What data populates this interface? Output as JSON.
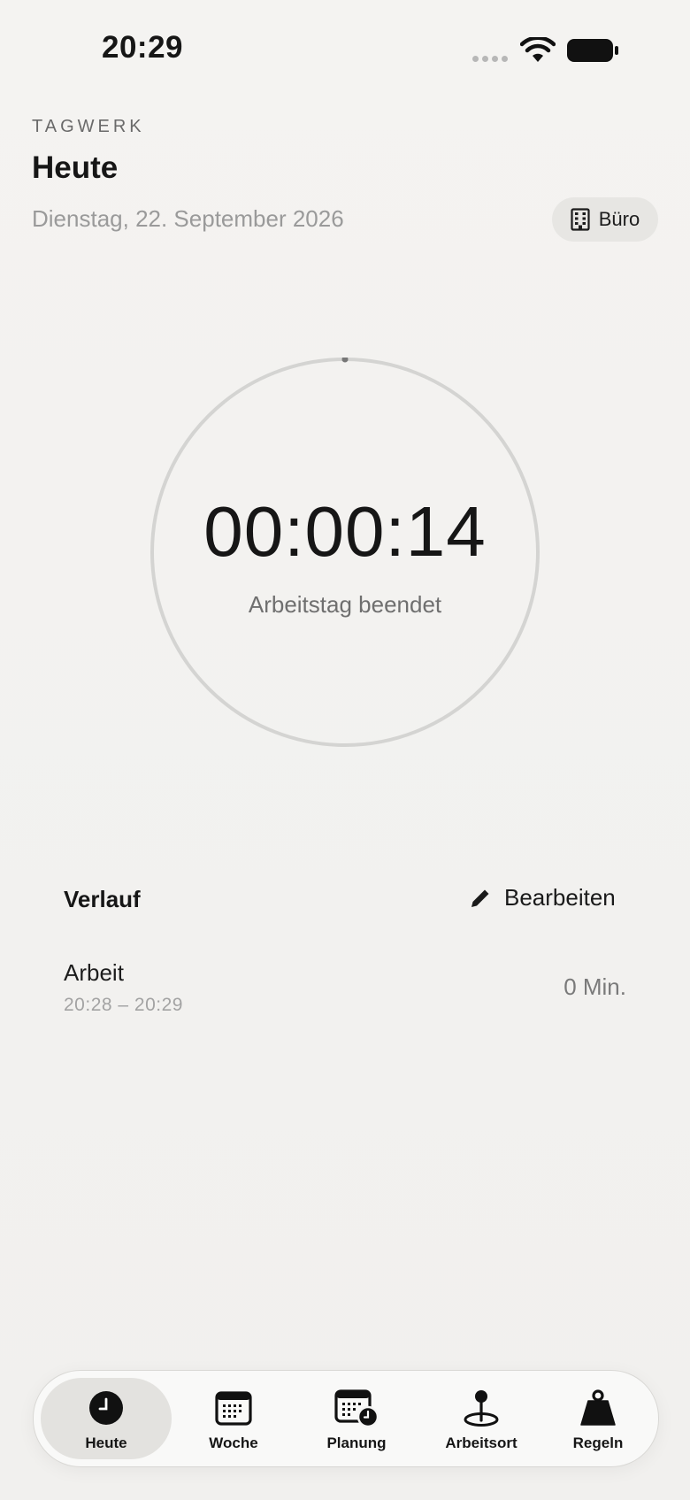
{
  "status_bar": {
    "time": "20:29"
  },
  "header": {
    "app_label": "TAGWERK",
    "title": "Heute",
    "date": "Dienstag, 22. September 2026",
    "location_chip": {
      "label": "Büro",
      "icon": "building-icon"
    }
  },
  "timer": {
    "elapsed": "00:00:14",
    "status": "Arbeitstag beendet",
    "progress": 0.0
  },
  "history": {
    "title": "Verlauf",
    "edit_label": "Bearbeiten",
    "edit_icon": "pencil-icon",
    "entries": [
      {
        "label": "Arbeit",
        "range": "20:28 – 20:29",
        "duration": "0 Min."
      }
    ]
  },
  "tab_bar": {
    "active": "Heute",
    "items": [
      {
        "label": "Heute",
        "icon": "clock-icon"
      },
      {
        "label": "Woche",
        "icon": "calendar-icon"
      },
      {
        "label": "Planung",
        "icon": "calendar-clock-icon"
      },
      {
        "label": "Arbeitsort",
        "icon": "map-pin-icon"
      },
      {
        "label": "Regeln",
        "icon": "weight-icon"
      }
    ]
  },
  "colors": {
    "background": "#f3f2f0",
    "text": "#161616",
    "muted": "#9a9a9a",
    "ring": "#d4d4d2"
  }
}
